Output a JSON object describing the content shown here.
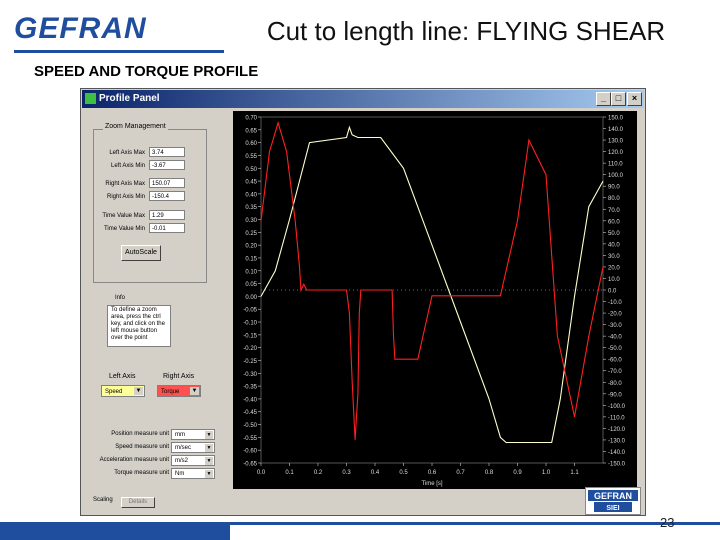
{
  "header": {
    "logo_text": "GEFRAN",
    "title": "Cut to length line: FLYING SHEAR",
    "subtitle": "SPEED AND TORQUE PROFILE",
    "page_number": "23",
    "brand_color": "#1f4e9e"
  },
  "window": {
    "title": "Profile Panel",
    "buttons": [
      "_",
      "□",
      "×"
    ]
  },
  "zoom": {
    "group_label": "Zoom Management",
    "rows": [
      {
        "label": "Left Axis Max",
        "value": "3.74"
      },
      {
        "label": "Left Axis Min",
        "value": "-3.67"
      },
      {
        "label": "Right Axis Max",
        "value": "150.07"
      },
      {
        "label": "Right Axis Min",
        "value": "-150.4"
      },
      {
        "label": "Time Value Max",
        "value": "1.29"
      },
      {
        "label": "Time Value Min",
        "value": "-0.01"
      }
    ],
    "autoscale_label": "AutoScale"
  },
  "info": {
    "label": "Info",
    "text": "To define a zoom area, press the ctrl key, and click on the left mouse button over the point"
  },
  "axes_select": {
    "left_label": "Left Axis",
    "right_label": "Right Axis",
    "left_value": "Speed",
    "right_value": "Torque",
    "left_color": "#ffff99",
    "right_color": "#ff5050"
  },
  "units": [
    {
      "label": "Position measure unit",
      "value": "mm"
    },
    {
      "label": "Speed measure unit",
      "value": "m/sec"
    },
    {
      "label": "Acceleration measure unit",
      "value": "m/s2"
    },
    {
      "label": "Torque measure unit",
      "value": "Nm"
    }
  ],
  "status": {
    "text": "Scaling",
    "button": "Details"
  },
  "badge": {
    "text": "GEFRAN",
    "sub": "SIEI"
  },
  "chart_data": {
    "type": "line",
    "xlabel": "Time [s]",
    "xlim": [
      0.0,
      1.2
    ],
    "x_ticks": [
      "0.0",
      "0.1",
      "0.2",
      "0.3",
      "0.4",
      "0.5",
      "0.6",
      "0.7",
      "0.8",
      "0.9",
      "1.0",
      "1.1"
    ],
    "left_ylim": [
      -0.65,
      0.7
    ],
    "right_ylim": [
      -150,
      150
    ],
    "left_ticks": [
      "0.70",
      "0.65",
      "0.60",
      "0.55",
      "0.50",
      "0.45",
      "0.40",
      "0.35",
      "0.30",
      "0.25",
      "0.20",
      "0.15",
      "0.10",
      "0.05",
      "0.00",
      "-0.05",
      "-0.10",
      "-0.15",
      "-0.20",
      "-0.25",
      "-0.30",
      "-0.35",
      "-0.40",
      "-0.45",
      "-0.50",
      "-0.55",
      "-0.60",
      "-0.65"
    ],
    "right_ticks": [
      "150.0",
      "140.0",
      "130.0",
      "120.0",
      "110.0",
      "100.0",
      "90.0",
      "80.0",
      "70.0",
      "60.0",
      "50.0",
      "40.0",
      "30.0",
      "20.0",
      "10.0",
      "0.0",
      "-10.0",
      "-20.0",
      "-30.0",
      "-40.0",
      "-50.0",
      "-60.0",
      "-70.0",
      "-80.0",
      "-90.0",
      "-100.0",
      "-110.0",
      "-120.0",
      "-130.0",
      "-140.0",
      "-150.0"
    ],
    "series": [
      {
        "name": "Speed",
        "color": "#ffffcc",
        "axis": "left",
        "x": [
          0.0,
          0.05,
          0.1,
          0.17,
          0.3,
          0.31,
          0.32,
          0.34,
          0.42,
          0.5,
          0.6,
          0.7,
          0.8,
          0.84,
          0.86,
          0.88,
          0.95,
          1.02,
          1.05,
          1.1,
          1.15,
          1.2
        ],
        "y": [
          0.0,
          0.1,
          0.3,
          0.6,
          0.62,
          0.66,
          0.63,
          0.62,
          0.62,
          0.5,
          0.2,
          -0.1,
          -0.4,
          -0.55,
          -0.57,
          -0.57,
          -0.57,
          -0.57,
          -0.4,
          0.0,
          0.35,
          0.45
        ]
      },
      {
        "name": "Torque",
        "color": "#ff2020",
        "axis": "right",
        "x": [
          0.0,
          0.03,
          0.06,
          0.09,
          0.12,
          0.135,
          0.14,
          0.15,
          0.16,
          0.2,
          0.3,
          0.31,
          0.32,
          0.33,
          0.34,
          0.345,
          0.35,
          0.4,
          0.46,
          0.465,
          0.47,
          0.52,
          0.55,
          0.6,
          0.8,
          0.84,
          0.9,
          0.94,
          1.0,
          1.04,
          1.1,
          1.15,
          1.2
        ],
        "y": [
          60,
          120,
          145,
          120,
          60,
          20,
          0,
          5,
          0,
          0,
          0,
          -20,
          -80,
          -130,
          -90,
          -20,
          0,
          0,
          0,
          -40,
          -60,
          -60,
          -60,
          -5,
          -5,
          -5,
          60,
          130,
          100,
          -40,
          -110,
          -40,
          20
        ]
      }
    ]
  }
}
